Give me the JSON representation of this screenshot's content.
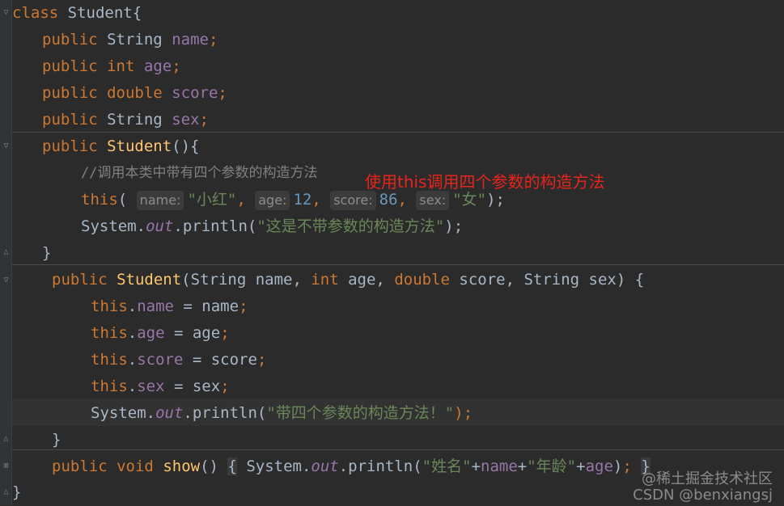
{
  "code": {
    "line1": {
      "class_kw": "class",
      "class_name": "Student{"
    },
    "line2": {
      "mod": "public",
      "type": "String",
      "field": "name",
      "semi": ";"
    },
    "line3": {
      "mod": "public",
      "type": "int",
      "field": "age",
      "semi": ";"
    },
    "line4": {
      "mod": "public",
      "type": "double",
      "field": "score",
      "semi": ";"
    },
    "line5": {
      "mod": "public",
      "type": "String",
      "field": "sex",
      "semi": ";"
    },
    "line6": {
      "mod": "public",
      "name": "Student",
      "rest": "(){"
    },
    "line7": {
      "comment": "//调用本类中带有四个参数的构造方法"
    },
    "line8": {
      "this_kw": "this",
      "open": "(",
      "hint_name": "name:",
      "val_name": "\"小红\"",
      "hint_age": "age:",
      "val_age": "12",
      "hint_score": "score:",
      "val_score": "86",
      "hint_sex": "sex:",
      "val_sex": "\"女\"",
      "close": ");"
    },
    "line9": {
      "system": "System.",
      "out": "out",
      "println": ".println(",
      "str": "\"这是不带参数的构造方法\"",
      "close": ");"
    },
    "line10": {
      "brace": "}"
    },
    "line11": {
      "mod": "public",
      "name": "Student",
      "open": "(",
      "p1_type": "String",
      "p1": " name, ",
      "p2_type": "int",
      "p2": " age, ",
      "p3_type": "double",
      "p3": " score, ",
      "p4_type": "String",
      "p4": " sex) {"
    },
    "line12": {
      "this_kw": "this",
      "field": "name",
      "rest": " = name",
      "semi": ";"
    },
    "line13": {
      "this_kw": "this",
      "field": "age",
      "rest": " = age",
      "semi": ";"
    },
    "line14": {
      "this_kw": "this",
      "field": "score",
      "rest": " = score",
      "semi": ";"
    },
    "line15": {
      "this_kw": "this",
      "field": "sex",
      "rest": " = sex",
      "semi": ";"
    },
    "line16": {
      "system": "System.",
      "out": "out",
      "println": ".println(",
      "str": "\"带四个参数的构造方法！\"",
      "close": ");"
    },
    "line17": {
      "brace": "}"
    },
    "line18": {
      "mod": "public",
      "void_kw": "void",
      "name": "show",
      "parens": "()",
      "open_brace": "{",
      "system": " System.",
      "out": "out",
      "println": ".println(",
      "str1": "\"姓名\"",
      "plus1": "+",
      "f1": "name",
      "plus2": "+",
      "str2": "\"年龄\"",
      "plus3": "+",
      "f2": "age",
      "close": ")",
      "semi": ";",
      "close_brace": "}"
    },
    "line19": {
      "brace": "}"
    }
  },
  "annotation": "使用this调用四个参数的构造方法",
  "watermark": {
    "line1": "@稀土掘金技术社区",
    "line2": "CSDN @benxiangsj"
  }
}
